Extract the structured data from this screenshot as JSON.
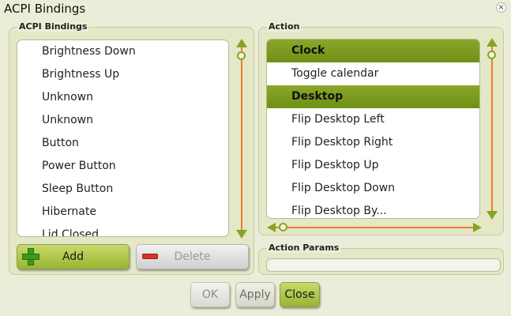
{
  "window": {
    "title": "ACPI Bindings",
    "close_glyph": "×"
  },
  "bindings": {
    "label": "ACPI Bindings",
    "items": [
      "Brightness Down",
      "Brightness Up",
      "Unknown",
      "Unknown",
      "Button",
      "Power Button",
      "Sleep Button",
      "Hibernate",
      "Lid Closed"
    ],
    "add_label": "Add",
    "delete_label": "Delete"
  },
  "action": {
    "label": "Action",
    "items": [
      {
        "text": "Clock",
        "header": true
      },
      {
        "text": "Toggle calendar",
        "header": false
      },
      {
        "text": "Desktop",
        "header": true
      },
      {
        "text": "Flip Desktop Left",
        "header": false
      },
      {
        "text": "Flip Desktop Right",
        "header": false
      },
      {
        "text": "Flip Desktop Up",
        "header": false
      },
      {
        "text": "Flip Desktop Down",
        "header": false
      },
      {
        "text": "Flip Desktop By...",
        "header": false
      }
    ]
  },
  "params": {
    "label": "Action Params",
    "value": ""
  },
  "footer": {
    "ok_label": "OK",
    "apply_label": "Apply",
    "close_label": "Close"
  },
  "colors": {
    "accent": "#7a9a1e",
    "scroll_track": "#f07a2c",
    "background": "#ecedd9"
  }
}
